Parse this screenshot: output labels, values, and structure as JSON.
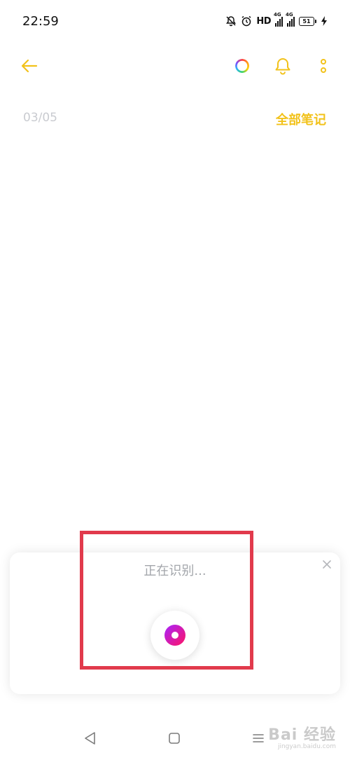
{
  "status_bar": {
    "time": "22:59",
    "hd_label": "HD",
    "signal_1_tag": "4G",
    "signal_2_tag": "4G",
    "battery_level": "51",
    "icons": [
      "mute-bell-icon",
      "alarm-icon",
      "hd-icon",
      "signal-4g-icon",
      "signal-4g-icon",
      "battery-icon",
      "charging-icon"
    ]
  },
  "app_bar": {
    "icons": [
      "back-arrow-icon",
      "color-ring-icon",
      "bell-icon",
      "more-vertical-icon"
    ]
  },
  "note": {
    "date": "03/05",
    "all_notes_label": "全部笔记"
  },
  "voice_panel": {
    "status_text": "正在识别...",
    "icons": [
      "close-icon",
      "mic-record-icon"
    ]
  },
  "nav_bar": {
    "icons": [
      "nav-back-icon",
      "nav-home-icon",
      "nav-menu-icon"
    ]
  },
  "watermark": {
    "main": "Bai 经验",
    "sub": "jingyan.baidu.com"
  },
  "colors": {
    "accent": "#f2c21a",
    "date_gray": "#c9cbd0",
    "highlight": "#e13a4c",
    "mic_gradient_start": "#a623ff",
    "mic_gradient_end": "#ff1564"
  }
}
